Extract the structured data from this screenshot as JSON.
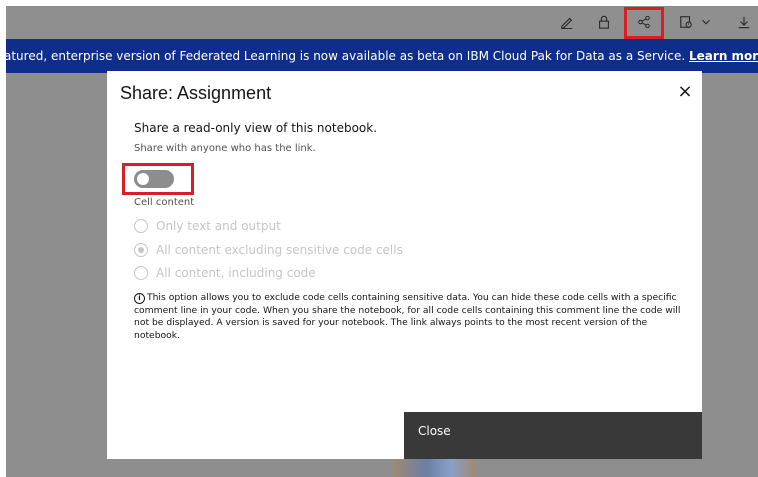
{
  "toolbar": {
    "icons": [
      "edit-icon",
      "lock-icon",
      "share-icon",
      "version-icon",
      "chevron-down-icon",
      "download-icon"
    ]
  },
  "banner": {
    "text": "atured, enterprise version of Federated Learning is now available as beta on IBM Cloud Pak for Data as a Service.",
    "link": "Learn more."
  },
  "modal": {
    "title": "Share: Assignment",
    "close_symbol": "×",
    "lead": "Share a read-only view of this notebook.",
    "sub": "Share with anyone who has the link.",
    "toggle_on": false,
    "cell_content_label": "Cell content",
    "options": [
      {
        "label": "Only text and output",
        "checked": false
      },
      {
        "label": "All content excluding sensitive code cells",
        "checked": true
      },
      {
        "label": "All content, including code",
        "checked": false
      }
    ],
    "info": "This option allows you to exclude code cells containing sensitive data. You can hide these code cells with a specific comment line in your code. When you share the notebook, for all code cells containing this comment line the code will not be displayed. A version is saved for your notebook. The link always points to the most recent version of the notebook.",
    "close_button": "Close"
  },
  "colors": {
    "banner_bg": "#0f2d8a",
    "highlight": "#da1e28",
    "close_button_bg": "#393939"
  }
}
